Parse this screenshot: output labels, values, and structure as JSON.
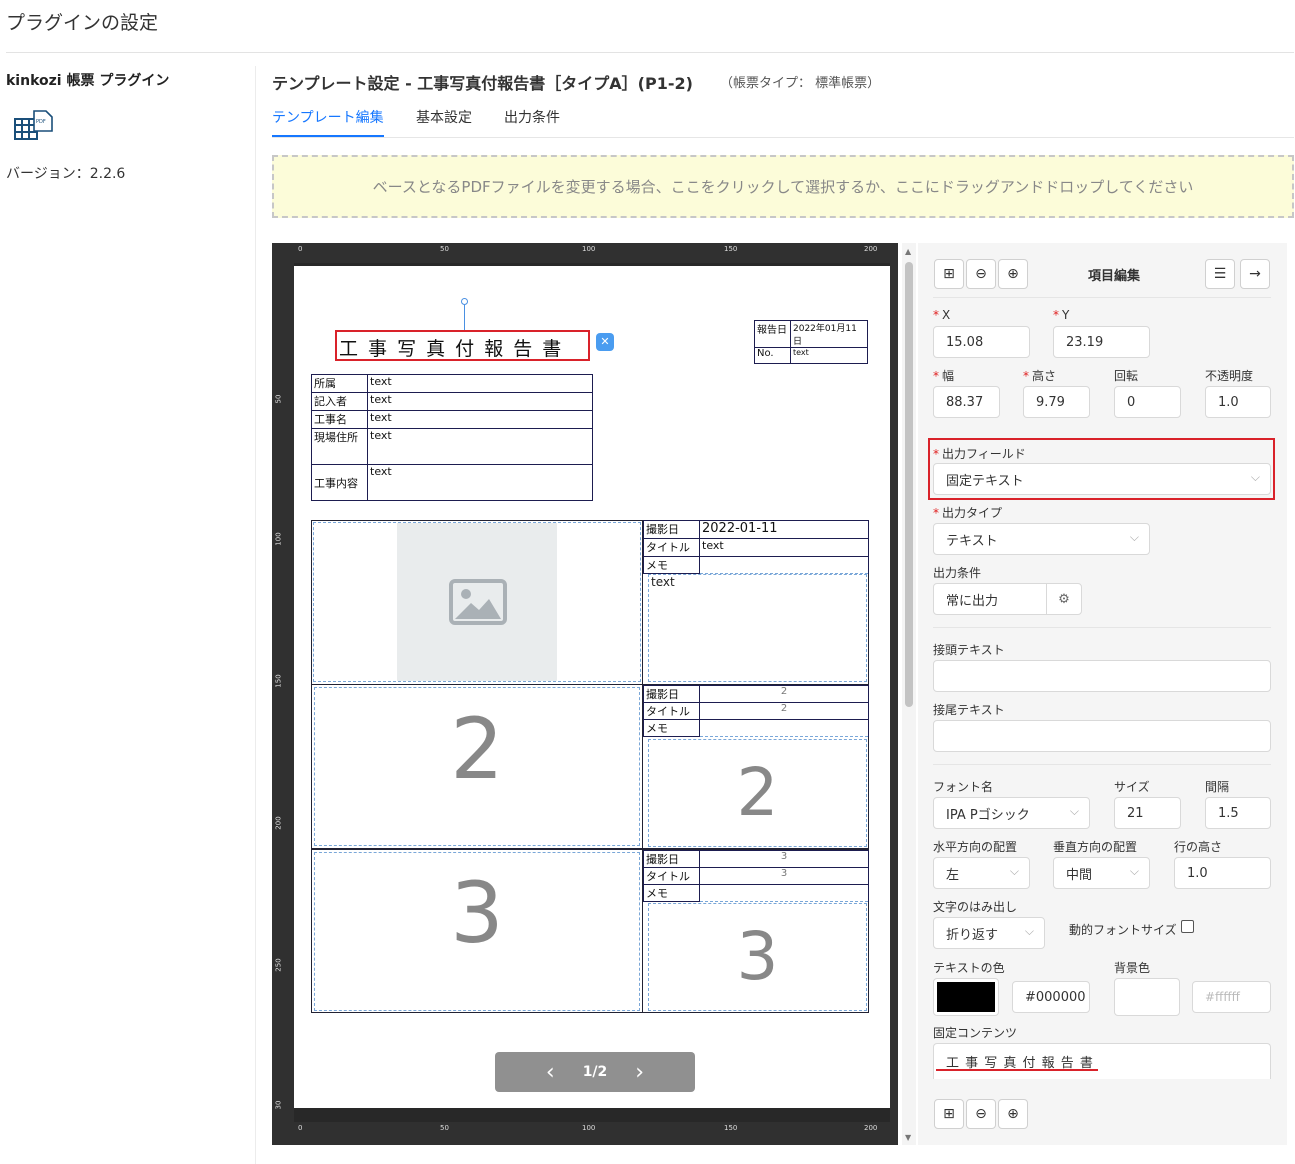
{
  "page": {
    "title": "プラグインの設定"
  },
  "plugin": {
    "name": "kinkozi 帳票 プラグイン",
    "version": "バージョン：2.2.6",
    "icon": "pdf-table-icon"
  },
  "template": {
    "title": "テンプレート設定 - 工事写真付報告書［タイプA］(P1-2)",
    "type_label": "（帳票タイプ： 標準帳票）",
    "tabs": [
      "テンプレート編集",
      "基本設定",
      "出力条件"
    ],
    "active_tab": 0
  },
  "dropzone": {
    "text": "ベースとなるPDFファイルを変更する場合、ここをクリックして選択するか、ここにドラッグアンドドロップしてください"
  },
  "ruler": {
    "top_marks": [
      "0",
      "50",
      "100",
      "150",
      "200"
    ],
    "left_marks": [
      "50",
      "100",
      "150",
      "200",
      "250",
      "30"
    ]
  },
  "document": {
    "title_text": "工 事 写 真 付 報 告 書",
    "report_date_label": "報告日",
    "report_date_value": "2022年01月11日",
    "no_label": "No.",
    "no_value": "text",
    "rows": [
      {
        "label": "所属",
        "value": "text"
      },
      {
        "label": "記入者",
        "value": "text"
      },
      {
        "label": "工事名",
        "value": "text"
      },
      {
        "label": "現場住所",
        "value": "text"
      },
      {
        "label": "工事内容",
        "value": "text"
      }
    ],
    "photo1": {
      "date_label": "撮影日",
      "date_value": "2022-01-11",
      "title_label": "タイトル",
      "title_value": "text",
      "memo_label": "メモ",
      "memo_value": "text"
    },
    "photo2": {
      "num": "2",
      "date_label": "撮影日",
      "date_value": "2",
      "title_label": "タイトル",
      "title_value": "2",
      "memo_label": "メモ",
      "memo_num": "2"
    },
    "photo3": {
      "num": "3",
      "date_label": "撮影日",
      "date_value": "3",
      "title_label": "タイトル",
      "title_value": "3",
      "memo_label": "メモ",
      "memo_num": "3"
    }
  },
  "pager": {
    "prev": "‹",
    "label": "1/2",
    "next": "›"
  },
  "panel": {
    "header": "項目編集",
    "x_label": "X",
    "x_value": "15.08",
    "y_label": "Y",
    "y_value": "23.19",
    "width_label": "幅",
    "width_value": "88.37",
    "height_label": "高さ",
    "height_value": "9.79",
    "rotate_label": "回転",
    "rotate_value": "0",
    "opacity_label": "不透明度",
    "opacity_value": "1.0",
    "field_label": "出力フィールド",
    "field_value": "固定テキスト",
    "type_label": "出力タイプ",
    "type_value": "テキスト",
    "cond_label": "出力条件",
    "cond_value": "常に出力",
    "prefix_label": "接頭テキスト",
    "prefix_value": "",
    "suffix_label": "接尾テキスト",
    "suffix_value": "",
    "font_label": "フォント名",
    "font_value": "IPA Pゴシック",
    "size_label": "サイズ",
    "size_value": "21",
    "spacing_label": "間隔",
    "spacing_value": "1.5",
    "halign_label": "水平方向の配置",
    "halign_value": "左",
    "valign_label": "垂直方向の配置",
    "valign_value": "中間",
    "lineh_label": "行の高さ",
    "lineh_value": "1.0",
    "overflow_label": "文字のはみ出し",
    "overflow_value": "折り返す",
    "dynfont_label": "動的フォントサイズ",
    "textcolor_label": "テキストの色",
    "textcolor_value": "#000000",
    "bgcolor_label": "背景色",
    "bgcolor_placeholder": "#ffffff",
    "fixed_label": "固定コンテンツ",
    "fixed_value": "工 事 写 真 付 報 告 書"
  },
  "colors": {
    "accent": "#1677ff",
    "highlight": "#d9222a",
    "dropzone_bg": "#fcfcd9"
  }
}
